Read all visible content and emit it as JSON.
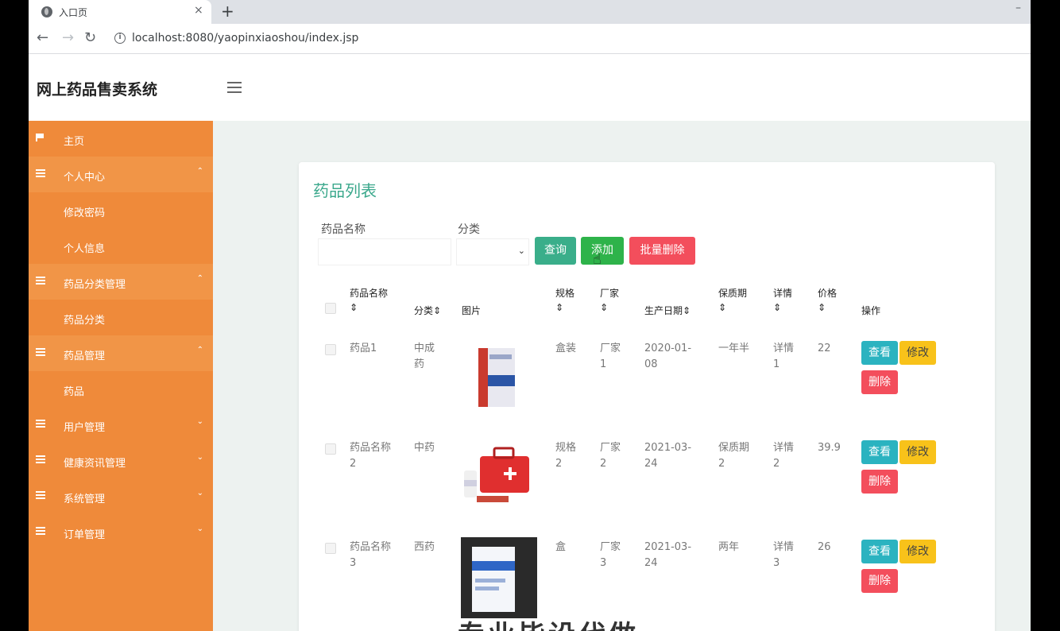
{
  "browser": {
    "tab_title": "入口页",
    "tab_close": "×",
    "new_tab": "+",
    "window_minimize": "–",
    "back": "←",
    "forward": "→",
    "reload": "↻",
    "info": "i",
    "url": "localhost:8080/yaopinxiaoshou/index.jsp"
  },
  "header": {
    "brand": "网上药品售卖系统"
  },
  "sidebar": {
    "items": [
      {
        "label": "主页",
        "icon": "flag-icon"
      },
      {
        "label": "个人中心",
        "icon": "list-icon",
        "chev": "⌃"
      },
      {
        "label": "修改密码"
      },
      {
        "label": "个人信息"
      },
      {
        "label": "药品分类管理",
        "icon": "list-icon",
        "chev": "⌃"
      },
      {
        "label": "药品分类"
      },
      {
        "label": "药品管理",
        "icon": "list-icon",
        "chev": "⌃"
      },
      {
        "label": "药品"
      },
      {
        "label": "用户管理",
        "icon": "list-icon",
        "chev": "⌄"
      },
      {
        "label": "健康资讯管理",
        "icon": "list-icon",
        "chev": "⌄"
      },
      {
        "label": "系统管理",
        "icon": "list-icon",
        "chev": "⌄"
      },
      {
        "label": "订单管理",
        "icon": "list-icon",
        "chev": "⌄"
      }
    ]
  },
  "main": {
    "title": "药品列表",
    "filters": {
      "name_label": "药品名称",
      "category_label": "分类",
      "select_chev": "⌄"
    },
    "buttons": {
      "query": "查询",
      "add": "添加",
      "batch_delete": "批量删除"
    },
    "table": {
      "headers": {
        "name": "药品名称",
        "category": "分类",
        "image": "图片",
        "spec": "规格",
        "maker": "厂家",
        "date": "生产日期",
        "shelf": "保质期",
        "detail": "详情",
        "price": "价格",
        "ops": "操作"
      },
      "sort_mark": "⇕",
      "row_buttons": {
        "view": "查看",
        "edit": "修改",
        "delete": "删除"
      },
      "rows": [
        {
          "name": "药品1",
          "category": "中成药",
          "spec": "盒装",
          "maker": "厂家1",
          "date": "2020-01-08",
          "shelf": "一年半",
          "detail": "详情1",
          "price": "22"
        },
        {
          "name": "药品名称2",
          "category": "中药",
          "spec": "规格2",
          "maker": "厂家2",
          "date": "2021-03-24",
          "shelf": "保质期2",
          "detail": "详情2",
          "price": "39.9"
        },
        {
          "name": "药品名称3",
          "category": "西药",
          "spec": "盒",
          "maker": "厂家3",
          "date": "2021-03-24",
          "shelf": "两年",
          "detail": "详情3",
          "price": "26"
        }
      ]
    }
  },
  "overlay": {
    "watermark": "专业毕设代做"
  }
}
